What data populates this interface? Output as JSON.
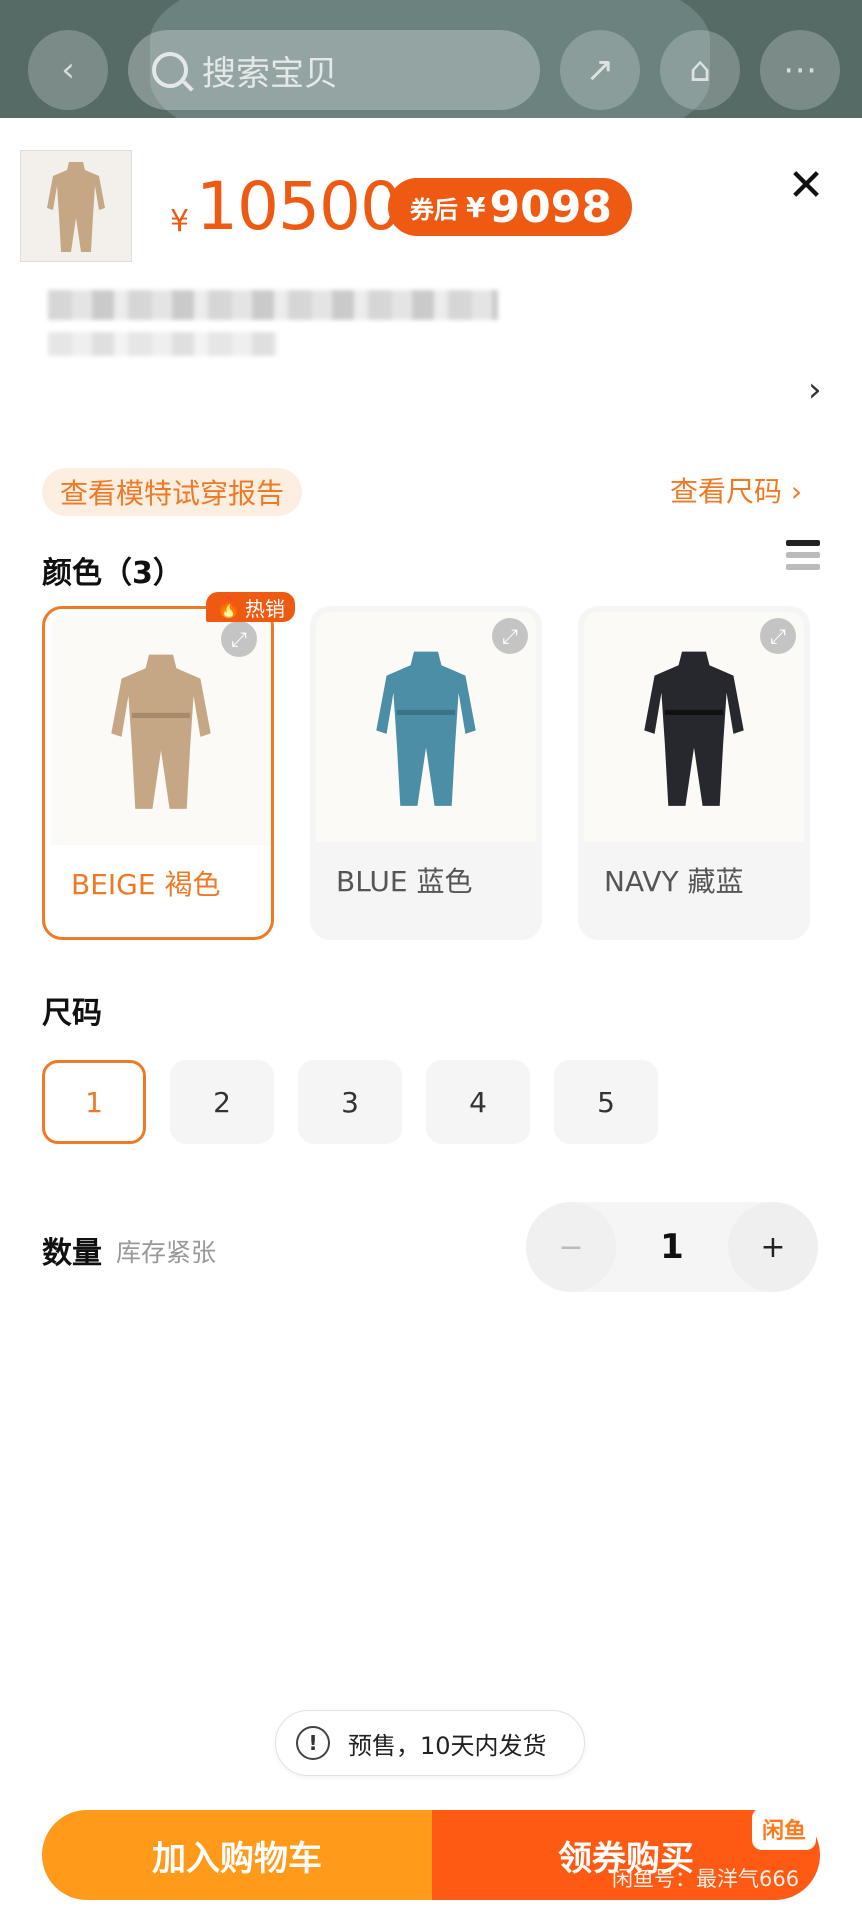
{
  "top_bar": {
    "search_placeholder": "搜索宝贝"
  },
  "product": {
    "price_symbol": "¥",
    "price": "10500",
    "coupon_label": "券后",
    "coupon_symbol": "¥",
    "coupon_price": "9098",
    "model_report_label": "查看模特试穿报告",
    "size_chart_label": "查看尺码",
    "size_chart_chevron": "›"
  },
  "color_section": {
    "title": "颜色（3）",
    "hot_badge": "热销",
    "options": [
      {
        "label": "BEIGE 褐色",
        "swatch": "#c6a785",
        "selected": true
      },
      {
        "label": "BLUE 蓝色",
        "swatch": "#4b8ea6",
        "selected": false
      },
      {
        "label": "NAVY 藏蓝",
        "swatch": "#26282e",
        "selected": false
      }
    ]
  },
  "size_section": {
    "title": "尺码",
    "options": [
      "1",
      "2",
      "3",
      "4",
      "5"
    ],
    "selected": "1"
  },
  "quantity_section": {
    "title": "数量",
    "stock_hint": "库存紧张",
    "minus": "−",
    "value": "1",
    "plus": "+"
  },
  "presale_notice": "预售，10天内发货",
  "actions": {
    "add_to_cart": "加入购物车",
    "buy": "领券购买"
  },
  "watermark": {
    "logo": "闲鱼",
    "text": "闲鱼号：最洋气666"
  },
  "colors": {
    "accent": "#ef7a26",
    "price": "#ef5a13",
    "cart_button": "#ff9a1a",
    "buy_button": "#ff5a13"
  }
}
